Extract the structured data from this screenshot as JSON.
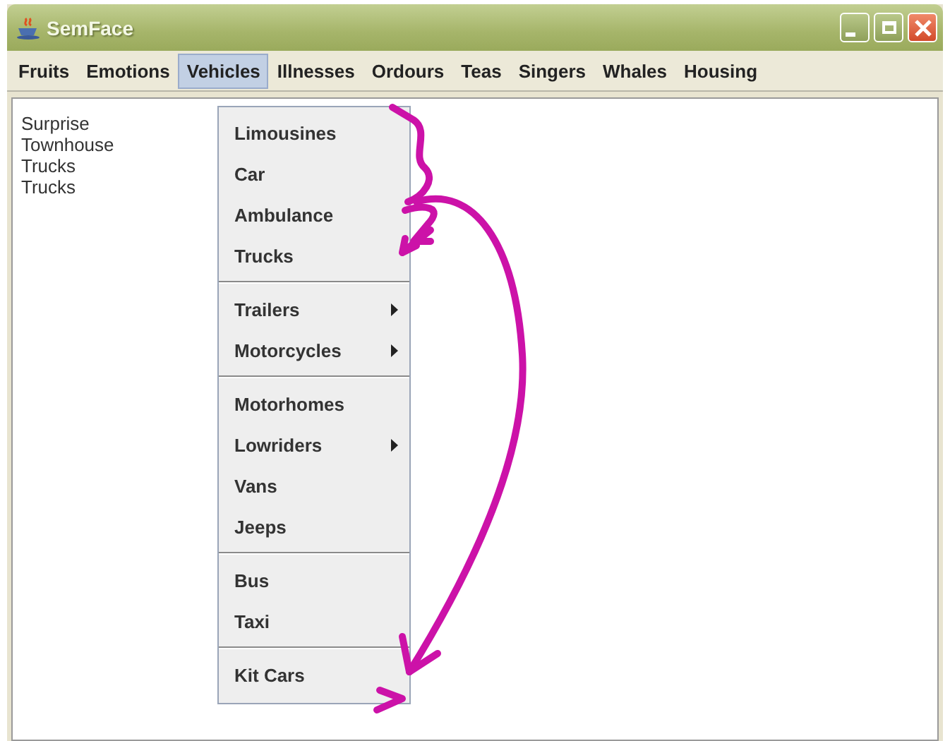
{
  "window": {
    "title": "SemFace"
  },
  "menus": [
    {
      "label": "Fruits",
      "selected": false
    },
    {
      "label": "Emotions",
      "selected": false
    },
    {
      "label": "Vehicles",
      "selected": true
    },
    {
      "label": "Illnesses",
      "selected": false
    },
    {
      "label": "Ordours",
      "selected": false
    },
    {
      "label": "Teas",
      "selected": false
    },
    {
      "label": "Singers",
      "selected": false
    },
    {
      "label": "Whales",
      "selected": false
    },
    {
      "label": "Housing",
      "selected": false
    }
  ],
  "dropdown": {
    "groups": [
      [
        {
          "label": "Limousines",
          "submenu": false
        },
        {
          "label": "Car",
          "submenu": false
        },
        {
          "label": "Ambulance",
          "submenu": false
        },
        {
          "label": "Trucks",
          "submenu": false
        }
      ],
      [
        {
          "label": "Trailers",
          "submenu": true
        },
        {
          "label": "Motorcycles",
          "submenu": true
        }
      ],
      [
        {
          "label": "Motorhomes",
          "submenu": false
        },
        {
          "label": "Lowriders",
          "submenu": true
        },
        {
          "label": "Vans",
          "submenu": false
        },
        {
          "label": "Jeeps",
          "submenu": false
        }
      ],
      [
        {
          "label": "Bus",
          "submenu": false
        },
        {
          "label": "Taxi",
          "submenu": false
        }
      ],
      [
        {
          "label": "Kit Cars",
          "submenu": false
        }
      ]
    ]
  },
  "content": {
    "lines": [
      "Surprise",
      "Townhouse",
      "Trucks",
      "Trucks"
    ]
  }
}
